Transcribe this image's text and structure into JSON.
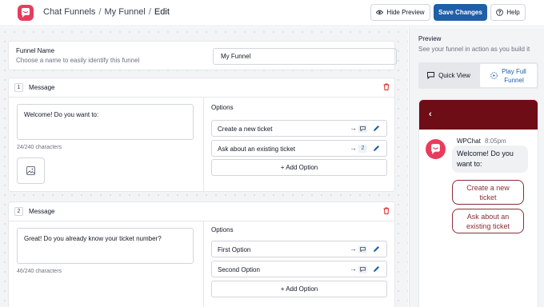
{
  "header": {
    "breadcrumb": [
      "Chat Funnels",
      "My Funnel",
      "Edit"
    ],
    "hide_preview_label": "Hide Preview",
    "save_label": "Save Changes",
    "help_label": "Help"
  },
  "funnel": {
    "name_label": "Funnel Name",
    "name_help": "Choose a name to easily identify this funnel",
    "name_value": "My Funnel"
  },
  "messages": [
    {
      "number": "1",
      "title": "Message",
      "text": "Welcome! Do you want to:",
      "chars": "24/240 characters",
      "options_title": "Options",
      "options": [
        {
          "label": "Create a new ticket",
          "target": ""
        },
        {
          "label": "Ask about an existing ticket",
          "target": "2"
        }
      ],
      "add_option_label": "+ Add Option"
    },
    {
      "number": "2",
      "title": "Message",
      "text": "Great! Do you already know your ticket number?",
      "chars": "46/240 characters",
      "options_title": "Options",
      "options": [
        {
          "label": "First Option",
          "target": ""
        },
        {
          "label": "Second Option",
          "target": ""
        }
      ],
      "add_option_label": "+ Add Option"
    }
  ],
  "preview": {
    "title": "Preview",
    "subtitle": "See your funnel in action as you build it",
    "quick_view_label": "Quick View",
    "play_full_line1": "Play Full",
    "play_full_line2": "Funnel",
    "chat": {
      "bot_name": "WPChat",
      "time": "8:05pm",
      "bubble_line1": "Welcome! Do you",
      "bubble_line2": "want to:",
      "replies": [
        {
          "line1": "Create a new",
          "line2": "ticket"
        },
        {
          "line1": "Ask about an",
          "line2": "existing ticket"
        }
      ]
    }
  },
  "colors": {
    "brand": "#e83c5d",
    "primary_button": "#1f5fa8",
    "chat_header": "#6e0d15",
    "reply_border": "#8b2d36",
    "delete_icon": "#dc2626"
  }
}
